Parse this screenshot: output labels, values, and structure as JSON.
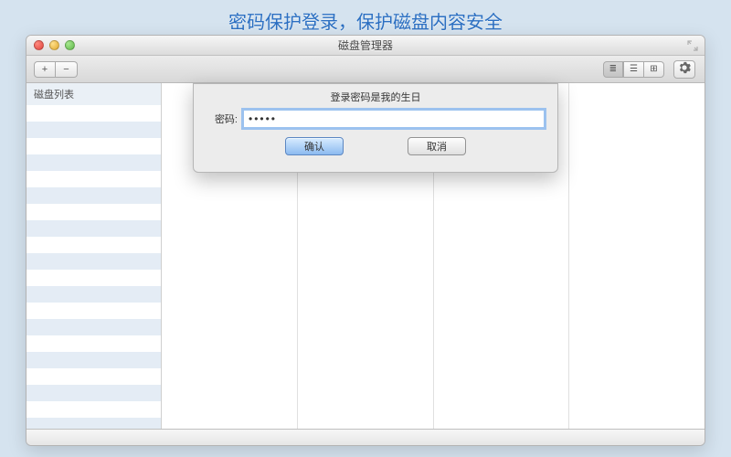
{
  "promo": {
    "title": "密码保护登录，保护磁盘内容安全"
  },
  "window": {
    "title": "磁盘管理器"
  },
  "toolbar": {
    "add_label": "+",
    "remove_label": "−",
    "view_list": "≣",
    "view_icon": "☰",
    "view_col": "⊞"
  },
  "sidebar": {
    "header": "磁盘列表"
  },
  "dialog": {
    "title": "登录密码是我的生日",
    "password_label": "密码:",
    "password_value": "•••••",
    "confirm_label": "确认",
    "cancel_label": "取消"
  }
}
